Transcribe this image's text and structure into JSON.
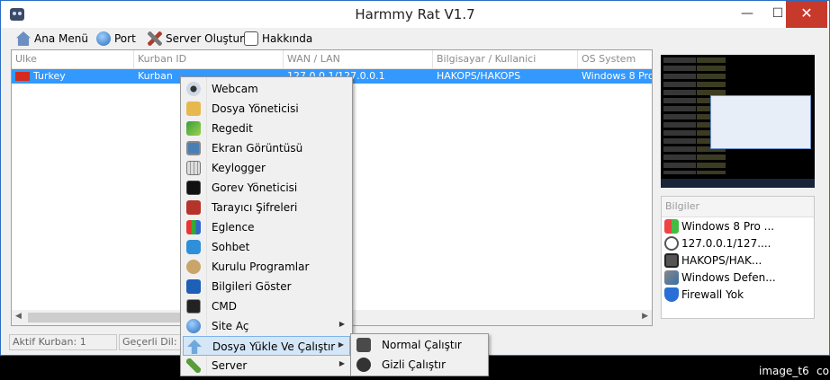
{
  "window": {
    "title": "Harmmy Rat V1.7",
    "min": "—",
    "max": "☐",
    "close": "✕"
  },
  "menu": [
    {
      "label": "Ana Menü",
      "icon": "home-icon"
    },
    {
      "label": "Port",
      "icon": "globe-icon"
    },
    {
      "label": "Server Oluştur",
      "icon": "tools-icon"
    },
    {
      "label": "Hakkında",
      "icon": "info-icon"
    }
  ],
  "table": {
    "columns": [
      "Ulke",
      "Kurban ID",
      "WAN / LAN",
      "Bilgisayar / Kullanici",
      "OS System"
    ],
    "rows": [
      [
        "Turkey",
        "Kurban",
        "127.0.0.1/127.0.0.1",
        "HAKOPS/HAKOPS",
        "Windows 8 Pro"
      ]
    ]
  },
  "status": {
    "kurban": "Aktif Kurban: 1",
    "dil": "Geçerli Dil: T"
  },
  "bilgiler": {
    "header": "Bilgiler",
    "items": [
      {
        "text": "Windows 8 Pro ...",
        "icon": "windows-icon"
      },
      {
        "text": "127.0.0.1/127....",
        "icon": "network-icon"
      },
      {
        "text": "HAKOPS/HAK...",
        "icon": "computer-icon"
      },
      {
        "text": "Windows Defen...",
        "icon": "defender-icon"
      },
      {
        "text": "Firewall Yok",
        "icon": "shield-icon"
      }
    ]
  },
  "context_menu": [
    {
      "label": "Webcam",
      "icon": "webcam-icon"
    },
    {
      "label": "Dosya Yöneticisi",
      "icon": "folder-icon"
    },
    {
      "label": "Regedit",
      "icon": "registry-icon"
    },
    {
      "label": "Ekran Görüntüsü",
      "icon": "monitor-icon"
    },
    {
      "label": "Keylogger",
      "icon": "keyboard-icon"
    },
    {
      "label": "Gorev Yöneticisi",
      "icon": "task-manager-icon"
    },
    {
      "label": "Tarayıcı Şifreleri",
      "icon": "browser-password-icon"
    },
    {
      "label": "Eglence",
      "icon": "fun-icon"
    },
    {
      "label": "Sohbet",
      "icon": "chat-icon"
    },
    {
      "label": "Kurulu Programlar",
      "icon": "programs-icon"
    },
    {
      "label": "Bilgileri Göster",
      "icon": "info-icon"
    },
    {
      "label": "CMD",
      "icon": "cmd-icon"
    },
    {
      "label": "Site Aç",
      "icon": "globe-icon",
      "submenu": true
    },
    {
      "label": "Dosya Yükle Ve Çalıştır",
      "icon": "upload-icon",
      "submenu": true,
      "highlighted": true
    },
    {
      "label": "Server",
      "icon": "plug-icon",
      "submenu": true
    }
  ],
  "submenu": [
    {
      "label": "Normal Çalıştır",
      "icon": "run-icon"
    },
    {
      "label": "Gizli Çalıştır",
      "icon": "hidden-run-icon"
    }
  ],
  "footer": {
    "label": "image_t6",
    "extra": "co"
  },
  "colors": {
    "selection": "#3399ff",
    "close": "#c7392b",
    "highlight": "#d5e6f7"
  }
}
